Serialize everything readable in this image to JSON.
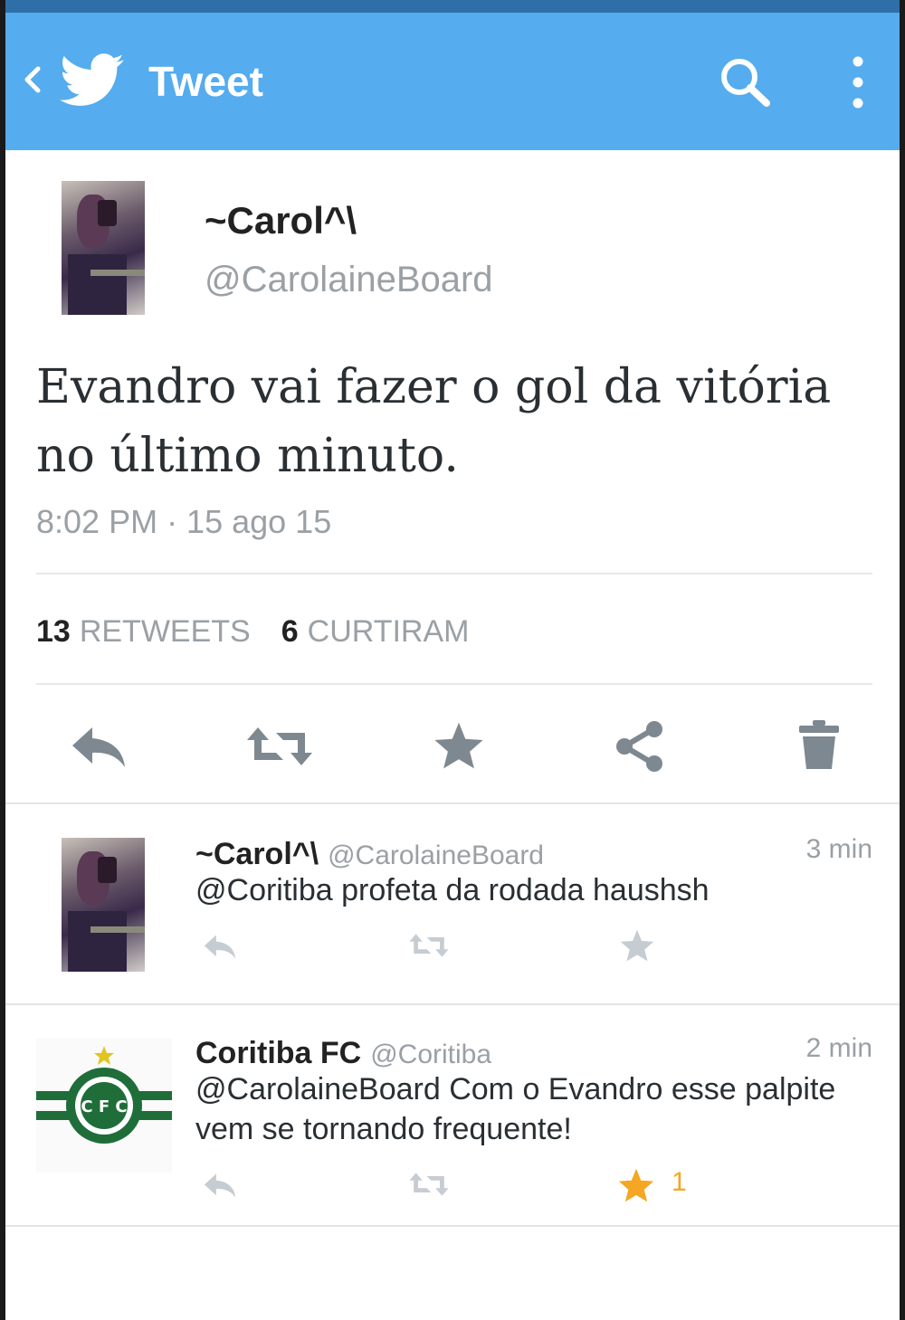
{
  "appbar": {
    "title": "Tweet",
    "color": "#55acee"
  },
  "tweet": {
    "display_name": "~Carol^\\",
    "handle": "@CarolaineBoard",
    "text": "Evandro vai fazer o gol da vitória no último minuto.",
    "timestamp": "8:02 PM · 15 ago 15",
    "retweets_count": "13",
    "retweets_label": "RETWEETS",
    "likes_count": "6",
    "likes_label": "CURTIRAM"
  },
  "actions": [
    "reply-icon",
    "retweet-icon",
    "favorite-icon",
    "share-icon",
    "delete-icon"
  ],
  "replies": [
    {
      "display_name": "~Carol^\\",
      "handle": "@CarolaineBoard",
      "time": "3 min",
      "text": "@Coritiba profeta da rodada haushsh",
      "favorite_count": ""
    },
    {
      "display_name": "Coritiba FC",
      "handle": "@Coritiba",
      "time": "2 min",
      "text": "@CarolaineBoard Com o Evandro esse palpite vem se tornando frequente!",
      "favorite_count": "1",
      "favorite_active_color": "#f5a623",
      "logo_text": "C F C"
    }
  ]
}
